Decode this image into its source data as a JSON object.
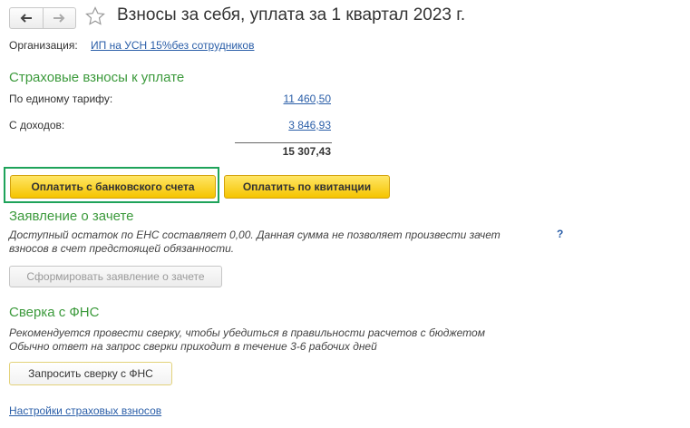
{
  "window": {
    "title": "Взносы за себя, уплата за 1 квартал 2023 г."
  },
  "organization": {
    "label": "Организация:",
    "value": "ИП на УСН 15%без сотрудников"
  },
  "contributions": {
    "heading": "Страховые взносы к уплате",
    "rows": [
      {
        "label": "По единому тарифу:",
        "value": "11 460,50"
      },
      {
        "label": "С доходов:",
        "value": "3 846,93"
      }
    ],
    "total": "15 307,43"
  },
  "actions": {
    "pay_bank": "Оплатить с банковского счета",
    "pay_receipt": "Оплатить по квитанции"
  },
  "offset": {
    "heading": "Заявление о зачете",
    "note_line1": "Доступный остаток по ЕНС составляет 0,00. Данная сумма не позволяет произвести зачет",
    "note_line2": "взносов в счет предстоящей обязанности.",
    "help": "?",
    "button": "Сформировать заявление о зачете"
  },
  "reconciliation": {
    "heading": "Сверка с ФНС",
    "note_line1": "Рекомендуется провести сверку, чтобы убедиться в правильности расчетов с бюджетом",
    "note_line2": "Обычно ответ на запрос сверки приходит в течение 3-6 рабочих дней",
    "button": "Запросить сверку с ФНС"
  },
  "footer": {
    "settings_link": "Настройки страховых взносов"
  },
  "colors": {
    "section_heading": "#3c9a3c",
    "link": "#2a5ea8",
    "primary_button": "#f5c400",
    "highlight_frame": "#1ea35a"
  }
}
